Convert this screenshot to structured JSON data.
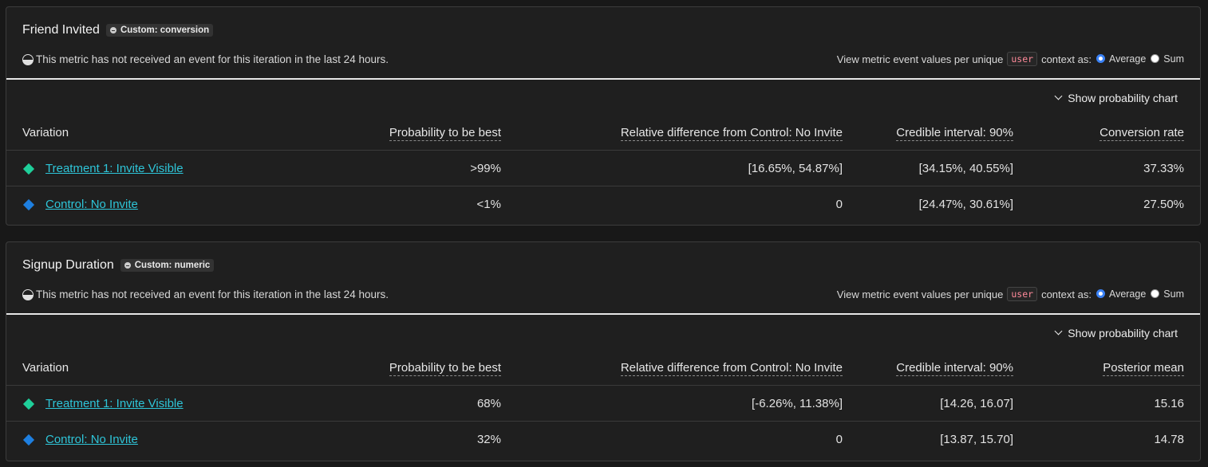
{
  "colors": {
    "treatment": "#1fcf9a",
    "control": "#1e7fe0",
    "link": "#2ec5d8"
  },
  "icons": {
    "badge": "metric-type-icon",
    "warning": "half-circle-status-icon",
    "toggle": "chevron-down-icon",
    "variation_marker": "diamond-icon"
  },
  "metrics": [
    {
      "title": "Friend Invited",
      "badge": "Custom: conversion",
      "warning": "This metric has not received an event for this iteration in the last 24 hours.",
      "context_prefix": "View metric event values per unique",
      "context_code": "user",
      "context_suffix": "context as:",
      "option_average": "Average",
      "option_sum": "Sum",
      "selected_option": "Average",
      "chart_toggle": "Show probability chart",
      "columns": {
        "variation": "Variation",
        "probability": "Probability to be best",
        "relative": "Relative difference from Control: No Invite",
        "interval": "Credible interval: 90%",
        "last": "Conversion rate"
      },
      "rows": [
        {
          "name": "Treatment 1: Invite Visible",
          "probability": ">99%",
          "relative": "[16.65%, 54.87%]",
          "interval": "[34.15%, 40.55%]",
          "last": "37.33%"
        },
        {
          "name": "Control: No Invite",
          "probability": "<1%",
          "relative": "0",
          "interval": "[24.47%, 30.61%]",
          "last": "27.50%"
        }
      ]
    },
    {
      "title": "Signup Duration",
      "badge": "Custom: numeric",
      "warning": "This metric has not received an event for this iteration in the last 24 hours.",
      "context_prefix": "View metric event values per unique",
      "context_code": "user",
      "context_suffix": "context as:",
      "option_average": "Average",
      "option_sum": "Sum",
      "selected_option": "Average",
      "chart_toggle": "Show probability chart",
      "columns": {
        "variation": "Variation",
        "probability": "Probability to be best",
        "relative": "Relative difference from Control: No Invite",
        "interval": "Credible interval: 90%",
        "last": "Posterior mean"
      },
      "rows": [
        {
          "name": "Treatment 1: Invite Visible",
          "probability": "68%",
          "relative": "[-6.26%, 11.38%]",
          "interval": "[14.26, 16.07]",
          "last": "15.16"
        },
        {
          "name": "Control: No Invite",
          "probability": "32%",
          "relative": "0",
          "interval": "[13.87, 15.70]",
          "last": "14.78"
        }
      ]
    }
  ]
}
